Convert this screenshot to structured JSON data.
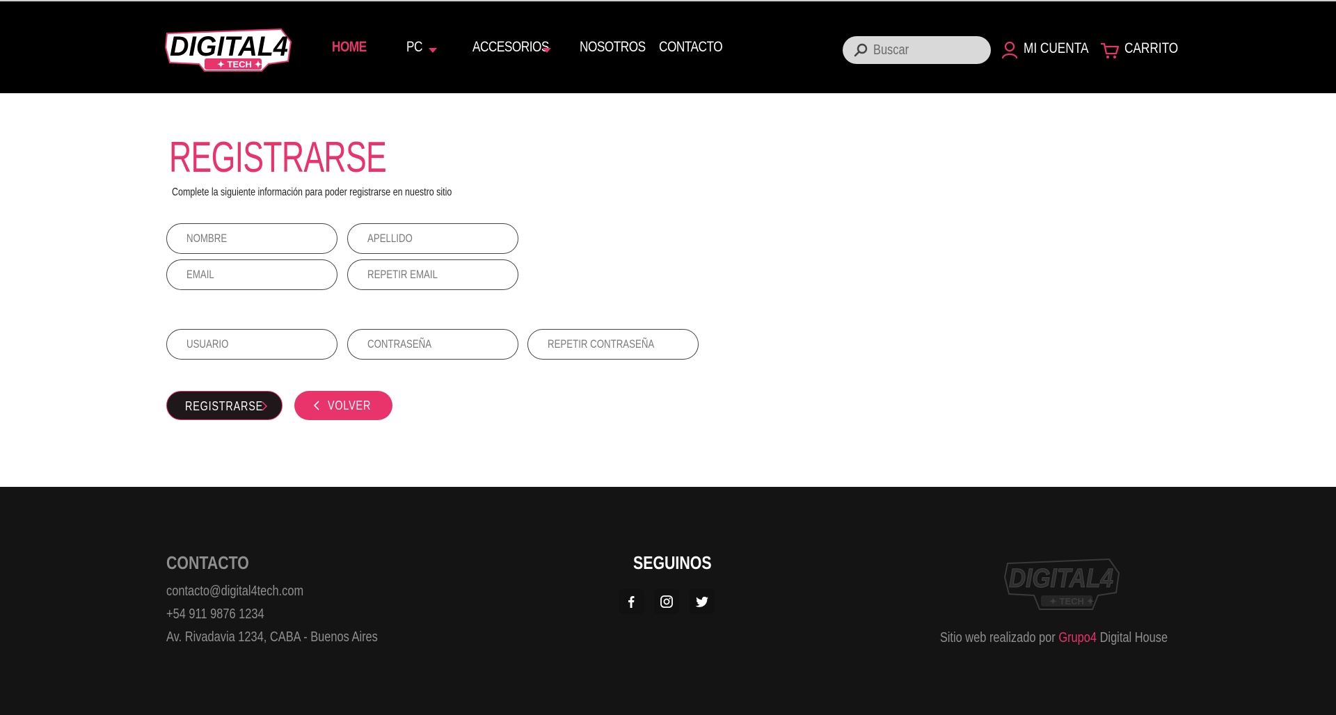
{
  "colors": {
    "accent": "#e8336b",
    "header_bg": "#000000",
    "footer_bg": "#141414",
    "button_dark": "#1f181b"
  },
  "header": {
    "logo": {
      "text": "DIGITAL4",
      "subtext": "TECH"
    },
    "nav": [
      {
        "label": "HOME",
        "active": true
      },
      {
        "label": "PC",
        "dropdown": true
      },
      {
        "label": "ACCESORIOS",
        "dropdown": true
      },
      {
        "label": "NOSOTROS"
      },
      {
        "label": "CONTACTO"
      }
    ],
    "search": {
      "placeholder": "Buscar",
      "icon": "search-icon"
    },
    "account": {
      "label": "MI CUENTA",
      "icon": "user-icon"
    },
    "cart": {
      "label": "CARRITO",
      "icon": "cart-icon"
    }
  },
  "register": {
    "title": "REGISTRARSE",
    "subtitle": "Complete la siguiente información para poder registrarse en nuestro sitio",
    "fields": {
      "nombre": "NOMBRE",
      "apellido": "APELLIDO",
      "email": "EMAIL",
      "repetir_email": "REPETIR EMAIL",
      "usuario": "USUARIO",
      "contrasena": "CONTRASEÑA",
      "repetir_contrasena": "REPETIR CONTRASEÑA"
    },
    "submit_label": "REGISTRARSE",
    "back_label": "VOLVER"
  },
  "footer": {
    "contact": {
      "heading": "CONTACTO",
      "email": "contacto@digital4tech.com",
      "phone": "+54 911 9876 1234",
      "address": "Av. Rivadavia 1234, CABA -  Buenos Aires"
    },
    "social": {
      "heading": "SEGUINOS",
      "icons": [
        "facebook-icon",
        "instagram-icon",
        "twitter-icon"
      ]
    },
    "credit": {
      "prefix": "Sitio web realizado por ",
      "group": "Grupo4",
      "suffix": " Digital House"
    }
  }
}
